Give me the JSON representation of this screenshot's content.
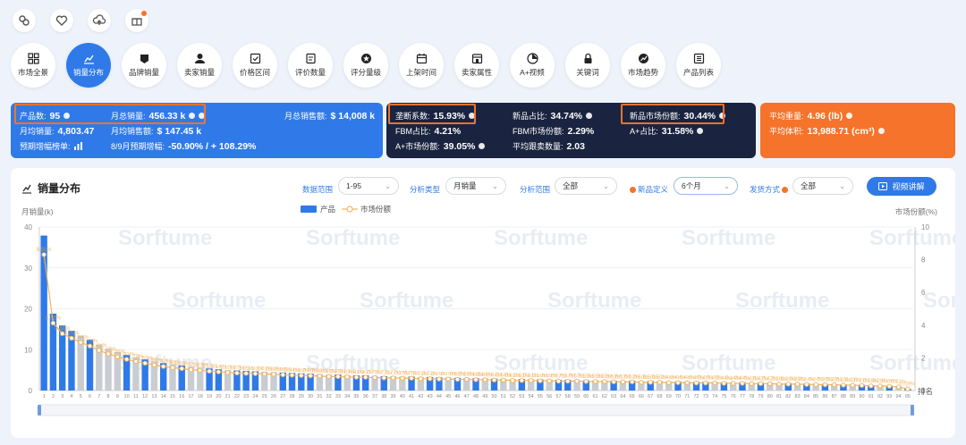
{
  "top_icons": [
    "brain-icon",
    "heart-icon",
    "cloud-upload-icon",
    "gift-icon"
  ],
  "tools": [
    {
      "label": "市场全景",
      "icon": "grid-icon",
      "active": false
    },
    {
      "label": "销量分布",
      "icon": "bar-chart-icon",
      "active": true
    },
    {
      "label": "品牌销量",
      "icon": "brand-icon",
      "active": false
    },
    {
      "label": "卖家销量",
      "icon": "seller-icon",
      "active": false
    },
    {
      "label": "价格区间",
      "icon": "price-icon",
      "active": false
    },
    {
      "label": "评价数量",
      "icon": "review-icon",
      "active": false
    },
    {
      "label": "评分量级",
      "icon": "star-icon",
      "active": false
    },
    {
      "label": "上架时间",
      "icon": "calendar-icon",
      "active": false
    },
    {
      "label": "卖家属性",
      "icon": "store-icon",
      "active": false
    },
    {
      "label": "A+视频",
      "icon": "video-icon",
      "active": false
    },
    {
      "label": "关键词",
      "icon": "lock-icon",
      "active": false
    },
    {
      "label": "市场趋势",
      "icon": "trend-icon",
      "active": false
    },
    {
      "label": "产品列表",
      "icon": "list-icon",
      "active": false
    }
  ],
  "stats_blue": {
    "product_count_label": "产品数:",
    "product_count": "95",
    "monthly_sales_label": "月总销量:",
    "monthly_sales": "456.33 k",
    "monthly_revenue_label": "月总销售额:",
    "monthly_revenue": "$ 14,008 k",
    "avg_sales_label": "月均销量:",
    "avg_sales": "4,803.47",
    "avg_revenue_label": "月均销售额:",
    "avg_revenue": "$ 147.45 k",
    "forecast_label": "预期增幅榜单:",
    "forecast_growth_label": "8/9月预期增幅:",
    "forecast_growth": "-50.90% / + 108.29%"
  },
  "stats_navy": {
    "monopoly_label": "垄断系数:",
    "monopoly": "15.93%",
    "new_ratio_label": "新品占比:",
    "new_ratio": "34.74%",
    "new_share_label": "新品市场份额:",
    "new_share": "30.44%",
    "fbm_ratio_label": "FBM占比:",
    "fbm_ratio": "4.21%",
    "fbm_share_label": "FBM市场份额:",
    "fbm_share": "2.29%",
    "aplus_ratio_label": "A+占比:",
    "aplus_ratio": "31.58%",
    "aplus_share_label": "A+市场份额:",
    "aplus_share": "39.05%",
    "avg_sellers_label": "平均跟卖数量:",
    "avg_sellers": "2.03"
  },
  "stats_orange": {
    "avg_weight_label": "平均重量:",
    "avg_weight": "4.96 (lb)",
    "avg_volume_label": "平均体积:",
    "avg_volume": "13,988.71 (cm³)"
  },
  "card": {
    "title": "销量分布",
    "range_label": "数据范围",
    "range_value": "1-95",
    "type_label": "分析类型",
    "type_value": "月销量",
    "scope_label": "分析范围",
    "scope_value": "全部",
    "newdef_label": "新品定义",
    "newdef_value": "6个月",
    "ship_label": "发货方式",
    "ship_value": "全部",
    "video_button": "视频讲解"
  },
  "colors": {
    "accent_blue": "#2f7ae8",
    "navy": "#1a2440",
    "orange": "#f5732a",
    "bar_blue": "#2f7ae8",
    "bar_gray": "#c9ccd1",
    "line_orange": "#f3b45c"
  },
  "chart_data": {
    "type": "bar",
    "left_axis_label": "月销量(k)",
    "right_axis_label": "市场份额(%)",
    "x_axis_label": "排名",
    "legend": [
      "产品",
      "市场份额"
    ],
    "left_ticks": [
      "0",
      "10",
      "20",
      "30",
      "40"
    ],
    "right_ticks": [
      "0",
      "2",
      "4",
      "6",
      "8",
      "10"
    ],
    "ylim_left": [
      0,
      40
    ],
    "ylim_right": [
      0,
      10
    ],
    "watermark": "Sorftume",
    "ranks": [
      1,
      2,
      3,
      4,
      5,
      6,
      7,
      8,
      9,
      10,
      11,
      12,
      13,
      14,
      15,
      16,
      17,
      18,
      19,
      20,
      21,
      22,
      23,
      24,
      25,
      26,
      27,
      28,
      29,
      30,
      31,
      32,
      33,
      34,
      35,
      36,
      37,
      38,
      39,
      40,
      41,
      42,
      43,
      44,
      45,
      46,
      47,
      48,
      49,
      50,
      51,
      52,
      53,
      54,
      55,
      56,
      57,
      58,
      59,
      60,
      61,
      62,
      63,
      64,
      65,
      66,
      67,
      68,
      69,
      70,
      71,
      72,
      73,
      74,
      75,
      76,
      77,
      78,
      79,
      80,
      81,
      82,
      83,
      84,
      85,
      86,
      87,
      88,
      89,
      90,
      91,
      92,
      93,
      94,
      95
    ],
    "sales_k": [
      37.9,
      18.8,
      15.9,
      14.6,
      13.4,
      12.4,
      11.2,
      10.2,
      9.4,
      8.7,
      8.1,
      7.6,
      7.1,
      6.7,
      6.4,
      6.1,
      5.8,
      5.6,
      5.4,
      5.2,
      5.0,
      4.9,
      4.8,
      4.7,
      4.6,
      4.5,
      4.4,
      4.3,
      4.2,
      4.1,
      4.0,
      3.9,
      3.9,
      3.8,
      3.7,
      3.7,
      3.6,
      3.5,
      3.5,
      3.4,
      3.4,
      3.3,
      3.3,
      3.2,
      3.2,
      3.1,
      3.1,
      3.0,
      3.0,
      2.9,
      2.9,
      2.8,
      2.8,
      2.8,
      2.7,
      2.7,
      2.6,
      2.6,
      2.6,
      2.5,
      2.5,
      2.5,
      2.4,
      2.4,
      2.4,
      2.3,
      2.3,
      2.3,
      2.2,
      2.2,
      2.2,
      2.1,
      2.1,
      2.1,
      2.0,
      2.0,
      2.0,
      1.9,
      1.9,
      1.9,
      1.8,
      1.8,
      1.8,
      1.7,
      1.7,
      1.6,
      1.6,
      1.5,
      1.5,
      1.4,
      1.3,
      1.3,
      1.2,
      1.0,
      0.4
    ],
    "is_new": [
      true,
      true,
      true,
      true,
      false,
      true,
      false,
      false,
      false,
      true,
      false,
      true,
      false,
      true,
      false,
      true,
      false,
      false,
      true,
      true,
      false,
      true,
      true,
      true,
      false,
      false,
      true,
      true,
      true,
      true,
      false,
      false,
      true,
      false,
      true,
      true,
      false,
      true,
      false,
      false,
      true,
      false,
      true,
      true,
      false,
      true,
      false,
      true,
      false,
      true,
      false,
      false,
      true,
      false,
      true,
      false,
      true,
      true,
      false,
      true,
      false,
      false,
      true,
      false,
      true,
      false,
      true,
      false,
      false,
      true,
      false,
      true,
      true,
      false,
      true,
      false,
      true,
      false,
      true,
      false,
      false,
      true,
      false,
      true,
      false,
      true,
      false,
      true,
      false,
      true,
      true,
      false,
      true,
      false,
      true
    ],
    "share_pct": [
      8.31,
      4.12,
      3.48,
      3.2,
      2.94,
      2.72,
      2.45,
      2.24,
      2.06,
      1.91,
      1.78,
      1.67,
      1.56,
      1.47,
      1.4,
      1.34,
      1.27,
      1.23,
      1.18,
      1.14,
      1.1,
      1.07,
      1.05,
      1.03,
      1.01,
      0.99,
      0.96,
      0.94,
      0.92,
      0.9,
      0.88,
      0.85,
      0.85,
      0.83,
      0.81,
      0.81,
      0.79,
      0.77,
      0.77,
      0.75,
      0.75,
      0.72,
      0.72,
      0.7,
      0.7,
      0.68,
      0.68,
      0.66,
      0.66,
      0.64,
      0.64,
      0.61,
      0.61,
      0.61,
      0.59,
      0.59,
      0.57,
      0.57,
      0.57,
      0.55,
      0.55,
      0.55,
      0.53,
      0.53,
      0.53,
      0.5,
      0.5,
      0.5,
      0.48,
      0.48,
      0.48,
      0.46,
      0.46,
      0.46,
      0.44,
      0.44,
      0.44,
      0.42,
      0.42,
      0.42,
      0.39,
      0.39,
      0.39,
      0.37,
      0.37,
      0.35,
      0.35,
      0.33,
      0.33,
      0.31,
      0.28,
      0.28,
      0.26,
      0.22,
      0.09
    ]
  }
}
